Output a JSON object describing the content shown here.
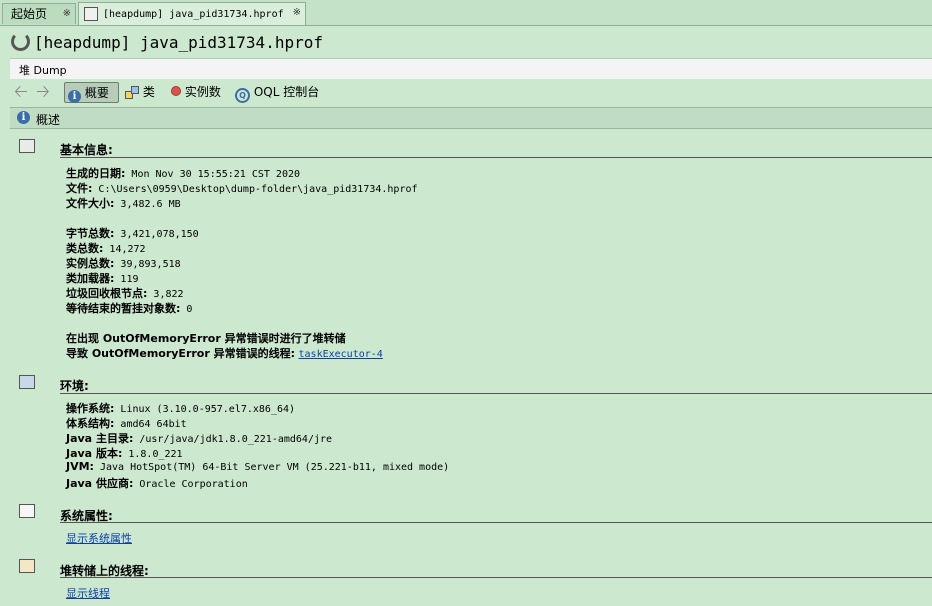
{
  "tabs": [
    {
      "label": "起始页",
      "close": "※"
    },
    {
      "label": "[heapdump] java_pid31734.hprof",
      "close": "※"
    }
  ],
  "header": {
    "title": "[heapdump] java_pid31734.hprof",
    "subtitle": "堆 Dump"
  },
  "toolbar": {
    "summary": "概要",
    "classes": "类",
    "instances": "实例数",
    "oql": "OQL 控制台"
  },
  "overview": {
    "label": "概述"
  },
  "basic": {
    "title": "基本信息:",
    "rows": [
      {
        "k": "生成的日期:",
        "v": " Mon Nov 30 15:55:21 CST 2020"
      },
      {
        "k": "文件:",
        "v": " C:\\Users\\0959\\Desktop\\dump-folder\\java_pid31734.hprof"
      },
      {
        "k": "文件大小:",
        "v": " 3,482.6 MB"
      },
      {
        "k": "字节总数:",
        "v": " 3,421,078,150"
      },
      {
        "k": "类总数:",
        "v": " 14,272"
      },
      {
        "k": "实例总数:",
        "v": " 39,893,518"
      },
      {
        "k": "类加载器:",
        "v": " 119"
      },
      {
        "k": "垃圾回收根节点:",
        "v": " 3,822"
      },
      {
        "k": "等待结束的暂挂对象数:",
        "v": " 0"
      }
    ],
    "oom_line": "在出现 OutOfMemoryError 异常错误时进行了堆转储",
    "oom_thread_label": "导致 OutOfMemoryError 异常错误的线程:",
    "oom_thread_link": "taskExecutor-4"
  },
  "env": {
    "title": "环境:",
    "rows": [
      {
        "k": "操作系统:",
        "v": " Linux (3.10.0-957.el7.x86_64)"
      },
      {
        "k": "体系结构:",
        "v": " amd64 64bit"
      },
      {
        "k": "Java 主目录:",
        "v": " /usr/java/jdk1.8.0_221-amd64/jre"
      },
      {
        "k": "Java 版本:",
        "v": " 1.8.0_221"
      },
      {
        "k": "JVM:",
        "v": " Java HotSpot(TM) 64-Bit Server VM (25.221-b11, mixed mode)"
      },
      {
        "k": "Java 供应商:",
        "v": " Oracle Corporation"
      }
    ]
  },
  "sysprops": {
    "title": "系统属性:",
    "link": "显示系统属性"
  },
  "threads": {
    "title": "堆转储上的线程:",
    "link": "显示线程"
  }
}
